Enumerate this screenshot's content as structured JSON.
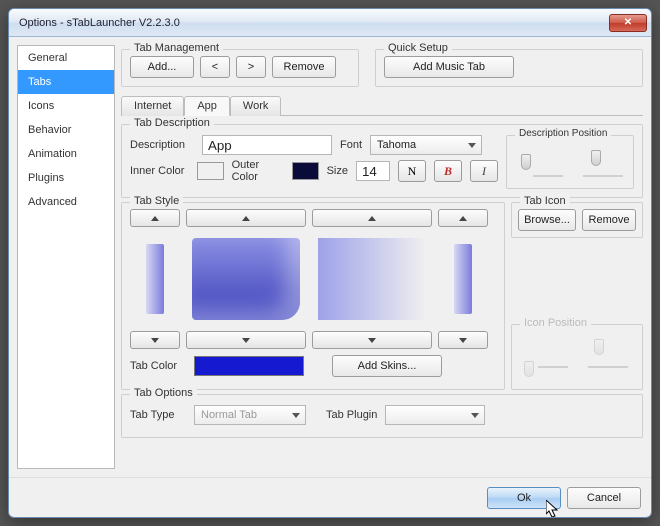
{
  "title": "Options - sTabLauncher V2.2.3.0",
  "sidebar": {
    "items": [
      {
        "label": "General"
      },
      {
        "label": "Tabs"
      },
      {
        "label": "Icons"
      },
      {
        "label": "Behavior"
      },
      {
        "label": "Animation"
      },
      {
        "label": "Plugins"
      },
      {
        "label": "Advanced"
      }
    ],
    "selected_index": 1
  },
  "tab_management": {
    "legend": "Tab Management",
    "add": "Add...",
    "prev": "<",
    "next": ">",
    "remove": "Remove"
  },
  "quick_setup": {
    "legend": "Quick Setup",
    "add_music": "Add Music Tab"
  },
  "inner_tabs": {
    "items": [
      "Internet",
      "App",
      "Work"
    ],
    "active_index": 1
  },
  "tab_description": {
    "legend": "Tab Description",
    "desc_label": "Description",
    "desc_value": "App",
    "font_label": "Font",
    "font_value": "Tahoma",
    "inner_color_label": "Inner Color",
    "inner_color": "#ffffff",
    "outer_color_label": "Outer Color",
    "outer_color": "#0b0b3a",
    "size_label": "Size",
    "size_value": "14",
    "btn_n": "N",
    "btn_b": "B",
    "btn_i": "I",
    "desc_pos_legend": "Description Position"
  },
  "tab_style": {
    "legend": "Tab Style",
    "tab_color_label": "Tab Color",
    "tab_color": "#1519cf",
    "add_skins": "Add Skins..."
  },
  "tab_icon": {
    "legend": "Tab Icon",
    "browse": "Browse...",
    "remove": "Remove",
    "icon_pos_legend": "Icon Position"
  },
  "tab_options": {
    "legend": "Tab Options",
    "type_label": "Tab Type",
    "type_value": "Normal Tab",
    "plugin_label": "Tab Plugin",
    "plugin_value": ""
  },
  "buttons": {
    "ok": "Ok",
    "cancel": "Cancel"
  }
}
